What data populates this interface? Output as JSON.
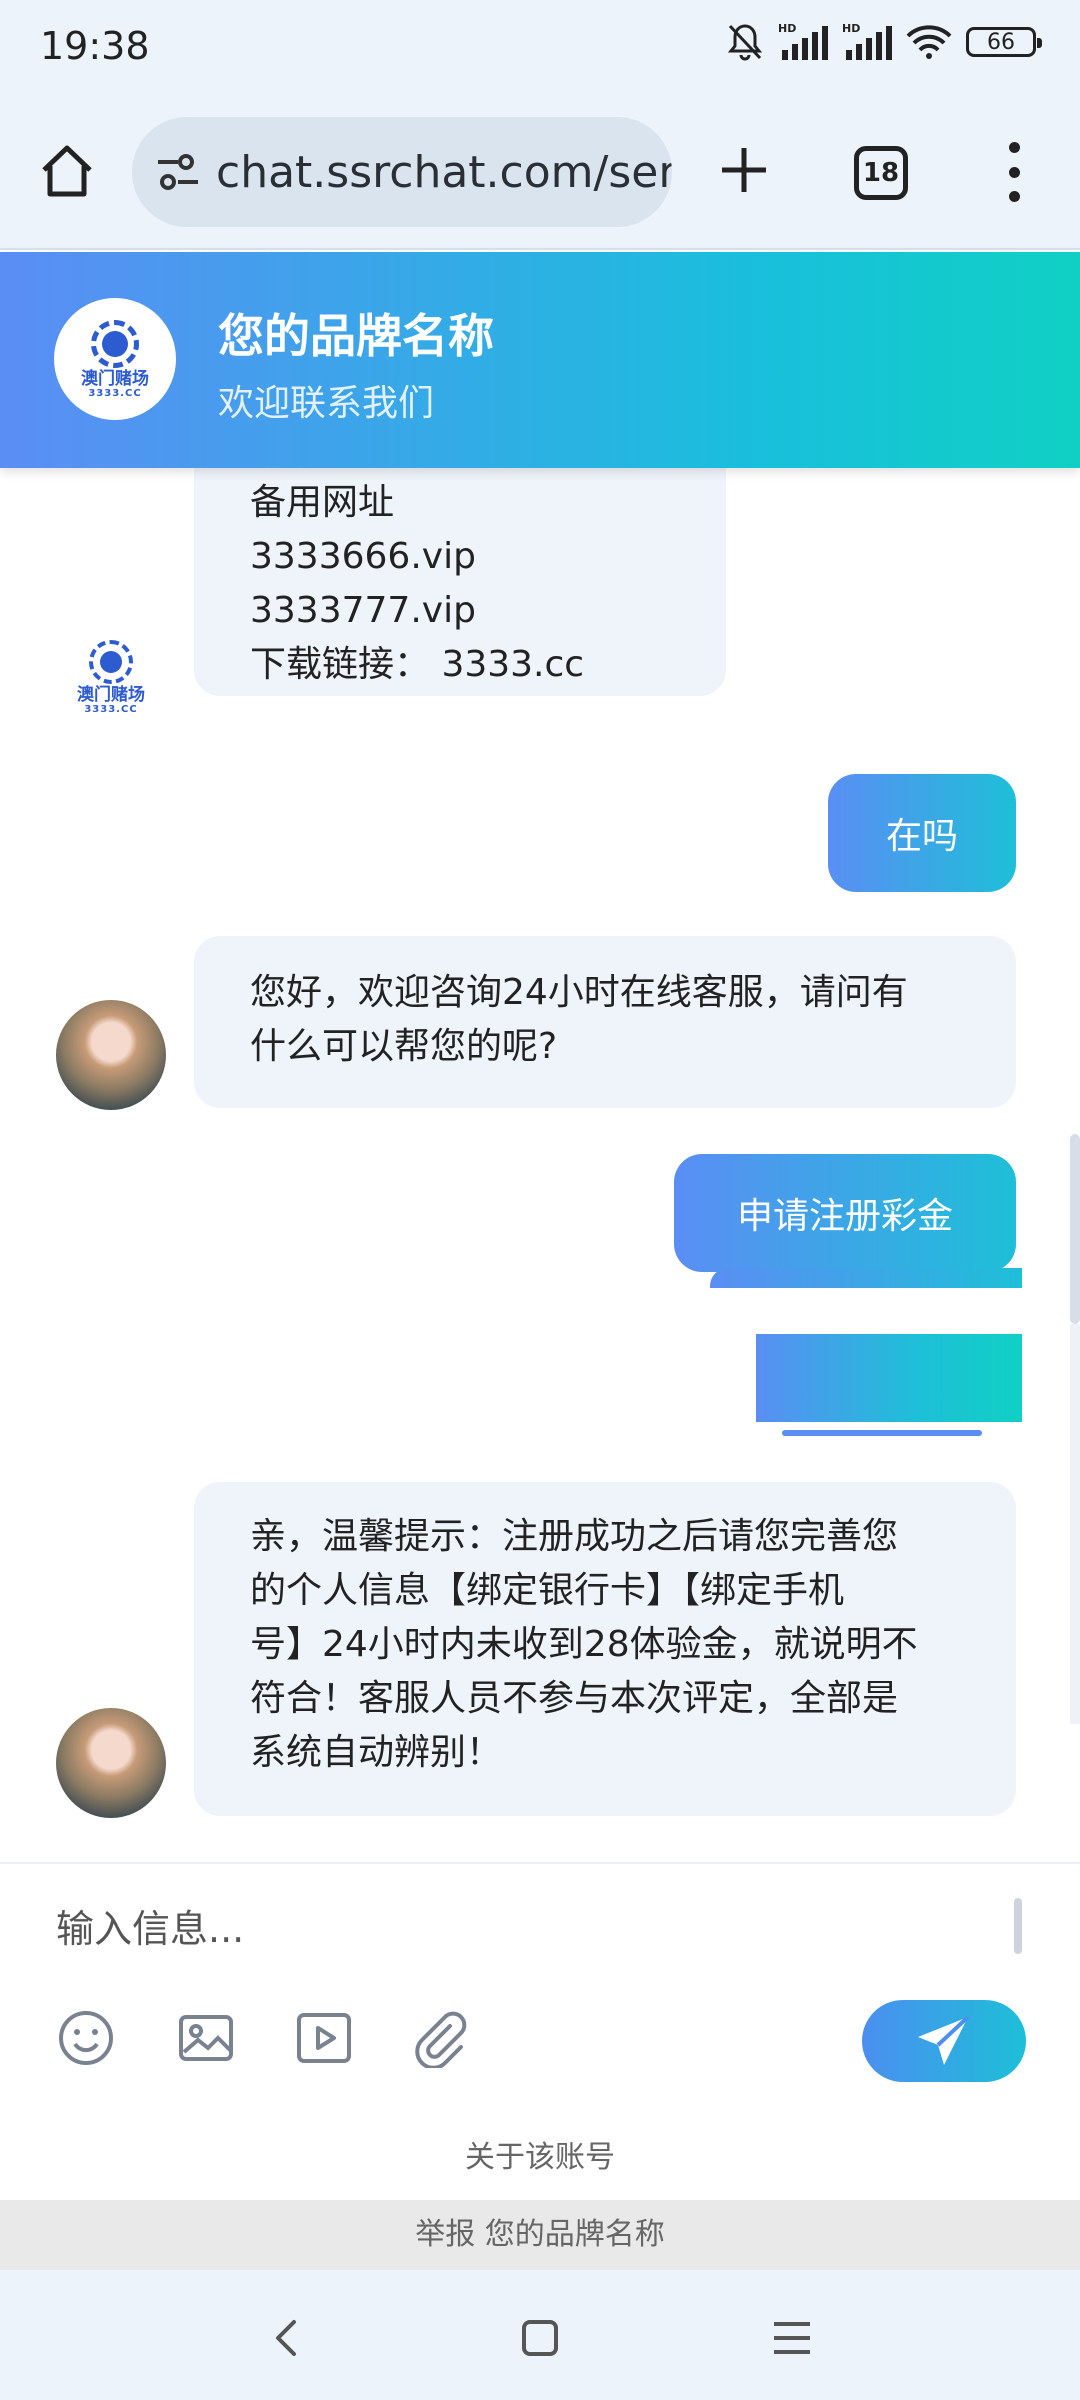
{
  "status_bar": {
    "time": "19:38",
    "battery": "66",
    "hd_label": "HD"
  },
  "browser": {
    "url": "chat.ssrchat.com/serv",
    "tab_count": "18"
  },
  "header": {
    "title": "您的品牌名称",
    "subtitle": "欢迎联系我们",
    "logo_text": "澳门赌场",
    "logo_domain": "3333.CC"
  },
  "messages": {
    "m1_lines": [
      "备用网址",
      "3333666.vip",
      "3333777.vip",
      "下载链接： 3333.cc"
    ],
    "m2": "在吗",
    "m3_lines": [
      "您好，欢迎咨询24小时在线客服，请问有",
      "什么可以帮您的呢?"
    ],
    "m4": "申请注册彩金",
    "m6_lines": [
      "亲，温馨提示：注册成功之后请您完善您",
      "的个人信息【绑定银行卡】【绑定手机",
      "号】24小时内未收到28体验金，就说明不",
      "符合！客服人员不参与本次评定，全部是",
      "系统自动辨别！"
    ]
  },
  "input": {
    "placeholder": "输入信息..."
  },
  "footer": {
    "about": "关于该账号",
    "report": "举报 您的品牌名称"
  },
  "icons": [
    "home-icon",
    "tune-icon",
    "plus-icon",
    "tabs-icon",
    "more-vert-icon",
    "emoji-icon",
    "image-icon",
    "video-icon",
    "attach-icon",
    "send-icon",
    "back-icon",
    "home-nav-icon",
    "recents-icon"
  ],
  "colors": {
    "header_gradient_start": "#5b8df5",
    "header_gradient_end": "#10d0c4",
    "bubble_in": "#eff4fb",
    "bubble_out_start": "#5a8ef4",
    "bubble_out_end": "#1ebfd8"
  }
}
